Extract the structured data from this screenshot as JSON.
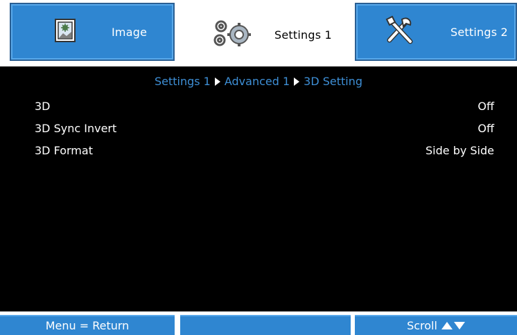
{
  "tabs": [
    {
      "label": "Image",
      "icon": "image-icon",
      "active": false
    },
    {
      "label": "Settings 1",
      "icon": "gears-icon",
      "active": true
    },
    {
      "label": "Settings 2",
      "icon": "tools-icon",
      "active": false
    }
  ],
  "breadcrumb": [
    "Settings 1",
    "Advanced 1",
    "3D Setting"
  ],
  "settings": [
    {
      "label": "3D",
      "value": "Off"
    },
    {
      "label": "3D Sync Invert",
      "value": "Off"
    },
    {
      "label": "3D Format",
      "value": "Side by Side"
    }
  ],
  "footer": {
    "left": "Menu = Return",
    "middle": "",
    "right": "Scroll"
  },
  "colors": {
    "tab_blue": "#2f86d1",
    "panel": "#000000",
    "breadcrumb": "#3e8fd6",
    "text": "#ffffff"
  }
}
